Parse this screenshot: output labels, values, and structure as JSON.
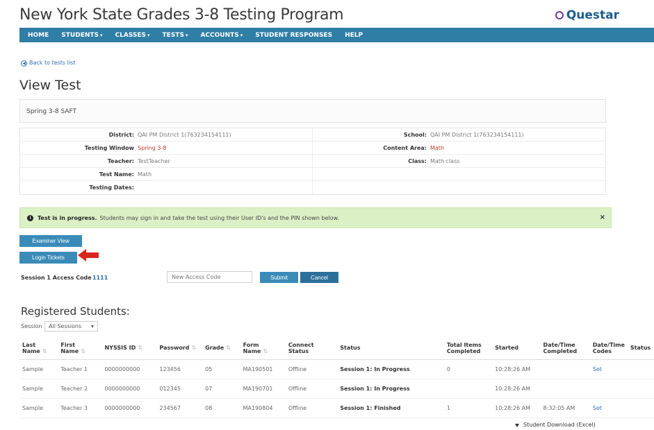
{
  "app_title": "New York State Grades 3-8 Testing Program",
  "brand": "Questar",
  "nav": {
    "items": [
      {
        "label": "HOME",
        "caret": false
      },
      {
        "label": "STUDENTS",
        "caret": true
      },
      {
        "label": "CLASSES",
        "caret": true
      },
      {
        "label": "TESTS",
        "caret": true
      },
      {
        "label": "ACCOUNTS",
        "caret": true
      },
      {
        "label": "STUDENT RESPONSES",
        "caret": false
      },
      {
        "label": "HELP",
        "caret": false
      }
    ]
  },
  "back_link": "Back to tests list",
  "page_title": "View Test",
  "test_title": "Spring 3-8 SAFT",
  "info": {
    "district_label": "District:",
    "district_value": "QAI PM District 1(763234154111)",
    "school_label": "School:",
    "school_value": "QAI PM District 1(763234154111)",
    "window_label": "Testing Window",
    "window_value": "Spring 3-8",
    "content_label": "Content Area:",
    "content_value": "Math",
    "teacher_label": "Teacher:",
    "teacher_value": "TestTeacher",
    "class_label": "Class:",
    "class_value": "Math class",
    "test_name_label": "Test Name:",
    "test_name_value": "Math",
    "dates_label": "Testing Dates:",
    "dates_value": ""
  },
  "banner": {
    "strong": "Test is in progress.",
    "text": "Students may sign in and take the test using their User ID's and the PIN shown below."
  },
  "buttons": {
    "examiner": "Examiner View",
    "login": "Login Tickets",
    "submit": "Submit",
    "cancel": "Cancel"
  },
  "access": {
    "label": "Session 1 Access Code",
    "code": "1111",
    "placeholder": "New Access Code"
  },
  "students_section": {
    "title": "Registered Students:",
    "session_label": "Session",
    "session_value": "All Sessions"
  },
  "table": {
    "headers": [
      "Last Name",
      "First Name",
      "NYSSIS ID",
      "Password",
      "Grade",
      "Form Name",
      "Connect Status",
      "Status",
      "Total Items Completed",
      "Started",
      "Date/Time Completed",
      "Date/Time Codes",
      "Status"
    ],
    "rows": [
      [
        "Sample",
        "Teacher 1",
        "0000000000",
        "123456",
        "05",
        "MA190501",
        "Offline",
        "Session 1: In Progress",
        "0",
        "10:28:26 AM",
        "",
        "Set",
        ""
      ],
      [
        "Sample",
        "Teacher 2",
        "0000000000",
        "012345",
        "07",
        "MA190701",
        "Offline",
        "Session 1: In Progress",
        "",
        "10:28:26 AM",
        "",
        "",
        ""
      ],
      [
        "Sample",
        "Teacher 3",
        "0000000000",
        "234567",
        "08",
        "MA190804",
        "Offline",
        "Session 1: Finished",
        "1",
        "10:28:26 AM",
        "8:32:05 AM",
        "Set",
        ""
      ]
    ]
  },
  "download": "Student Download (Excel)"
}
